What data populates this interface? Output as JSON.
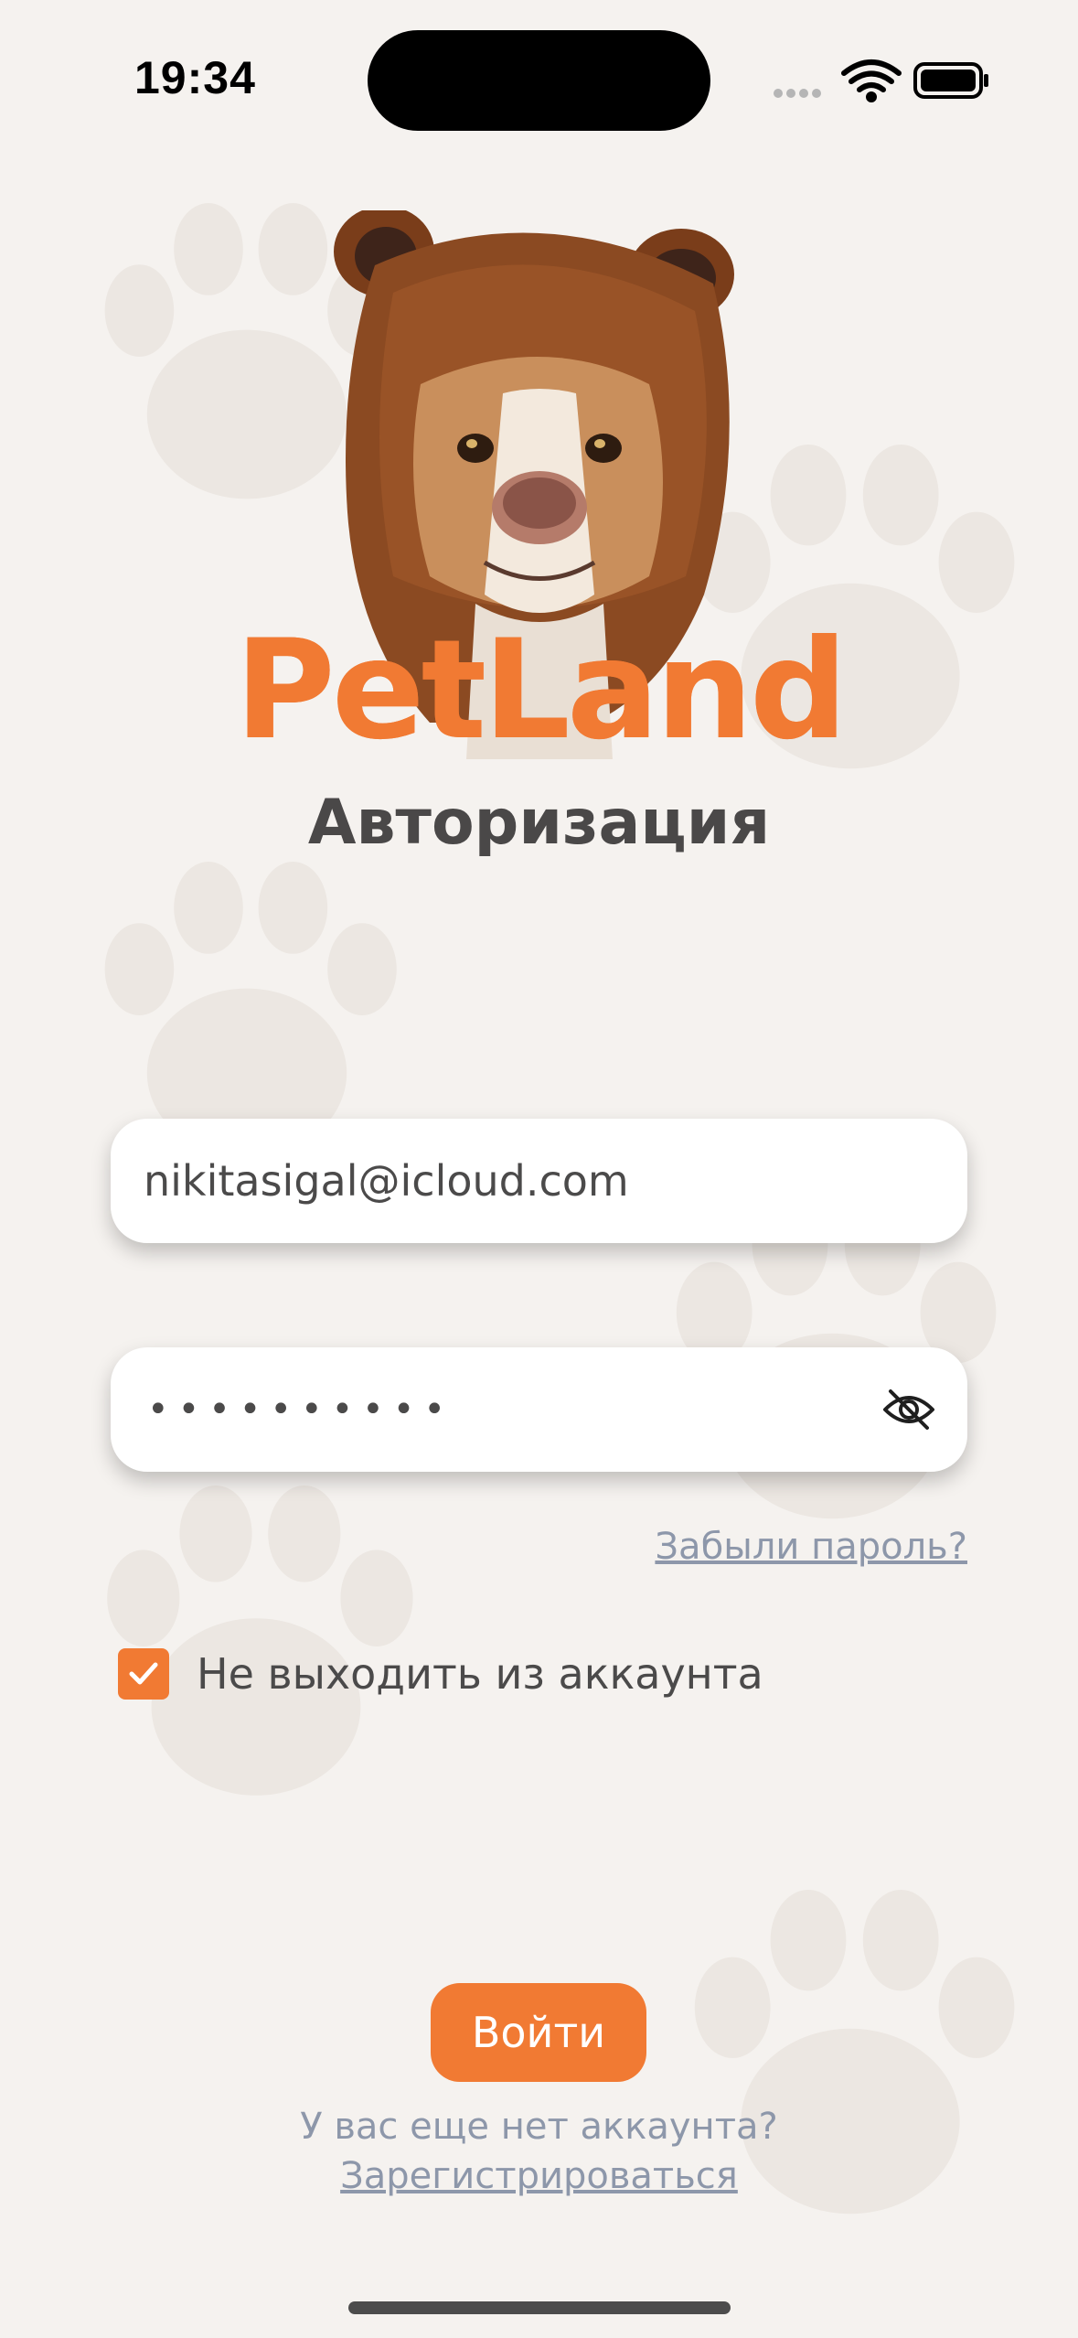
{
  "status_bar": {
    "time": "19:34",
    "signal_icon": "signal-dots-icon",
    "wifi_icon": "wifi-icon",
    "battery_icon": "battery-icon"
  },
  "logo": {
    "image": "dog-in-bear-hood-image",
    "brand_text": "PetLand",
    "brand_color": "#f17a33"
  },
  "page_title": "Авторизация",
  "form": {
    "email_value": "nikitasigal@icloud.com",
    "password_masked": "••••••••••",
    "password_toggle_icon": "eye-slash-icon",
    "forgot_password": "Забыли пароль?",
    "remember_me_label": "Не выходить из аккаунта",
    "remember_me_checked": true,
    "login_button": "Войти"
  },
  "footer": {
    "no_account_text": "У вас еще нет аккаунта?",
    "register_link": "Зарегистрироваться"
  },
  "colors": {
    "accent": "#f17a33",
    "background": "#f5f2ef",
    "link": "#8d97aa",
    "text": "#4b4a4a"
  }
}
